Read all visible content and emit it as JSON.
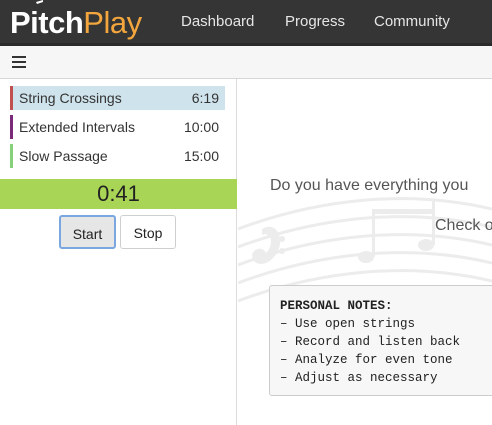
{
  "app": {
    "logo_part1": "Pitch",
    "logo_part2": "Play",
    "accent_color": "#f3a63d",
    "nav": [
      {
        "label": "Dashboard"
      },
      {
        "label": "Progress"
      },
      {
        "label": "Community"
      }
    ]
  },
  "toolbar": {
    "menu_icon": "hamburger-icon"
  },
  "sidebar": {
    "exercises": [
      {
        "name": "String Crossings",
        "time": "6:19",
        "color": "#c0504d",
        "active": true
      },
      {
        "name": "Extended Intervals",
        "time": "10:00",
        "color": "#7b2a7b",
        "active": false
      },
      {
        "name": "Slow Passage",
        "time": "15:00",
        "color": "#86d07a",
        "active": false
      }
    ],
    "timer": "0:41",
    "timer_color": "#a8d555",
    "start_label": "Start",
    "stop_label": "Stop"
  },
  "main": {
    "question": "Do you have everything you",
    "check": "Check o",
    "notes": {
      "title": "PERSONAL NOTES:",
      "lines": [
        "– Use open strings",
        "– Record and listen back",
        "– Analyze for even tone",
        "– Adjust as necessary"
      ]
    }
  }
}
